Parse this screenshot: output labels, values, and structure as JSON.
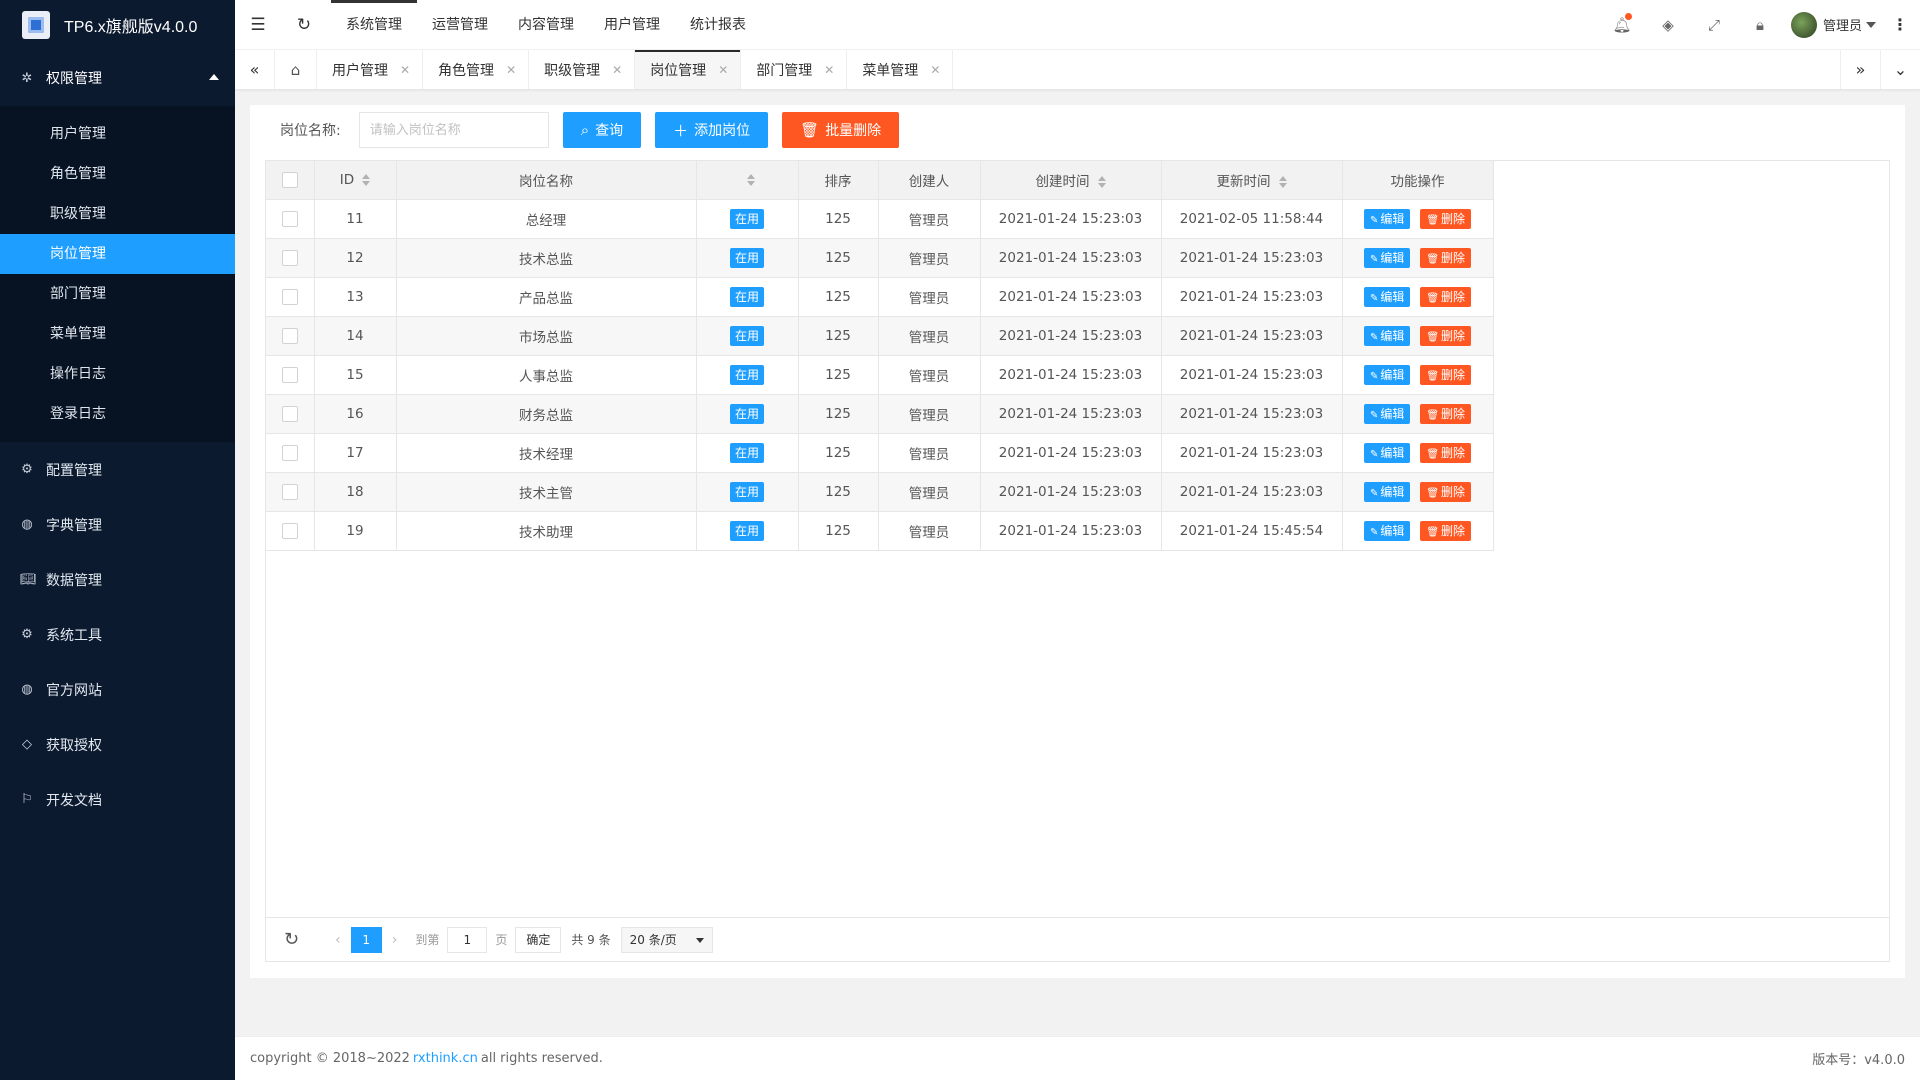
{
  "app": {
    "title": "TP6.x旗舰版v4.0.0"
  },
  "sidebar": {
    "open_group": {
      "label": "权限管理",
      "icon": "gear-icon"
    },
    "sub_items": [
      {
        "label": "用户管理",
        "active": false
      },
      {
        "label": "角色管理",
        "active": false
      },
      {
        "label": "职级管理",
        "active": false
      },
      {
        "label": "岗位管理",
        "active": true
      },
      {
        "label": "部门管理",
        "active": false
      },
      {
        "label": "菜单管理",
        "active": false
      },
      {
        "label": "操作日志",
        "active": false
      },
      {
        "label": "登录日志",
        "active": false
      }
    ],
    "groups": [
      {
        "label": "配置管理",
        "icon": "gear-icon",
        "expandable": true
      },
      {
        "label": "字典管理",
        "icon": "globe-icon",
        "expandable": true
      },
      {
        "label": "数据管理",
        "icon": "book-icon",
        "expandable": true
      },
      {
        "label": "系统工具",
        "icon": "gear-icon",
        "expandable": true
      },
      {
        "label": "官方网站",
        "icon": "globe-icon",
        "expandable": false
      },
      {
        "label": "获取授权",
        "icon": "diamond-icon",
        "expandable": false
      },
      {
        "label": "开发文档",
        "icon": "flag-icon",
        "expandable": false
      }
    ]
  },
  "header": {
    "nav": [
      "系统管理",
      "运营管理",
      "内容管理",
      "用户管理",
      "统计报表"
    ],
    "user": "管理员"
  },
  "tabs": [
    {
      "label": "用户管理",
      "active": false
    },
    {
      "label": "角色管理",
      "active": false
    },
    {
      "label": "职级管理",
      "active": false
    },
    {
      "label": "岗位管理",
      "active": true
    },
    {
      "label": "部门管理",
      "active": false
    },
    {
      "label": "菜单管理",
      "active": false
    }
  ],
  "search": {
    "label": "岗位名称:",
    "placeholder": "请输入岗位名称",
    "query_btn": "查询",
    "add_btn": "添加岗位",
    "batch_delete_btn": "批量删除"
  },
  "table": {
    "columns": [
      "ID",
      "岗位名称",
      "",
      "排序",
      "创建人",
      "创建时间",
      "更新时间",
      "功能操作"
    ],
    "status_label": "在用",
    "edit_label": "编辑",
    "delete_label": "删除",
    "rows": [
      {
        "id": "11",
        "name": "总经理",
        "sort": "125",
        "creator": "管理员",
        "created": "2021-01-24 15:23:03",
        "updated": "2021-02-05 11:58:44"
      },
      {
        "id": "12",
        "name": "技术总监",
        "sort": "125",
        "creator": "管理员",
        "created": "2021-01-24 15:23:03",
        "updated": "2021-01-24 15:23:03"
      },
      {
        "id": "13",
        "name": "产品总监",
        "sort": "125",
        "creator": "管理员",
        "created": "2021-01-24 15:23:03",
        "updated": "2021-01-24 15:23:03"
      },
      {
        "id": "14",
        "name": "市场总监",
        "sort": "125",
        "creator": "管理员",
        "created": "2021-01-24 15:23:03",
        "updated": "2021-01-24 15:23:03"
      },
      {
        "id": "15",
        "name": "人事总监",
        "sort": "125",
        "creator": "管理员",
        "created": "2021-01-24 15:23:03",
        "updated": "2021-01-24 15:23:03"
      },
      {
        "id": "16",
        "name": "财务总监",
        "sort": "125",
        "creator": "管理员",
        "created": "2021-01-24 15:23:03",
        "updated": "2021-01-24 15:23:03"
      },
      {
        "id": "17",
        "name": "技术经理",
        "sort": "125",
        "creator": "管理员",
        "created": "2021-01-24 15:23:03",
        "updated": "2021-01-24 15:23:03"
      },
      {
        "id": "18",
        "name": "技术主管",
        "sort": "125",
        "creator": "管理员",
        "created": "2021-01-24 15:23:03",
        "updated": "2021-01-24 15:23:03"
      },
      {
        "id": "19",
        "name": "技术助理",
        "sort": "125",
        "creator": "管理员",
        "created": "2021-01-24 15:23:03",
        "updated": "2021-01-24 15:45:54"
      }
    ]
  },
  "pager": {
    "current": "1",
    "goto_label": "到第",
    "goto_value": "1",
    "page_label": "页",
    "ok_label": "确定",
    "total": "共 9 条",
    "page_size": "20 条/页"
  },
  "footer": {
    "copyright_prefix": "copyright © 2018~2022",
    "link": "rxthink.cn",
    "copyright_suffix": "all rights reserved.",
    "version": "版本号：v4.0.0"
  },
  "colors": {
    "primary": "#1e9fff",
    "danger": "#ff5722",
    "sidebar": "#0c1a30"
  }
}
